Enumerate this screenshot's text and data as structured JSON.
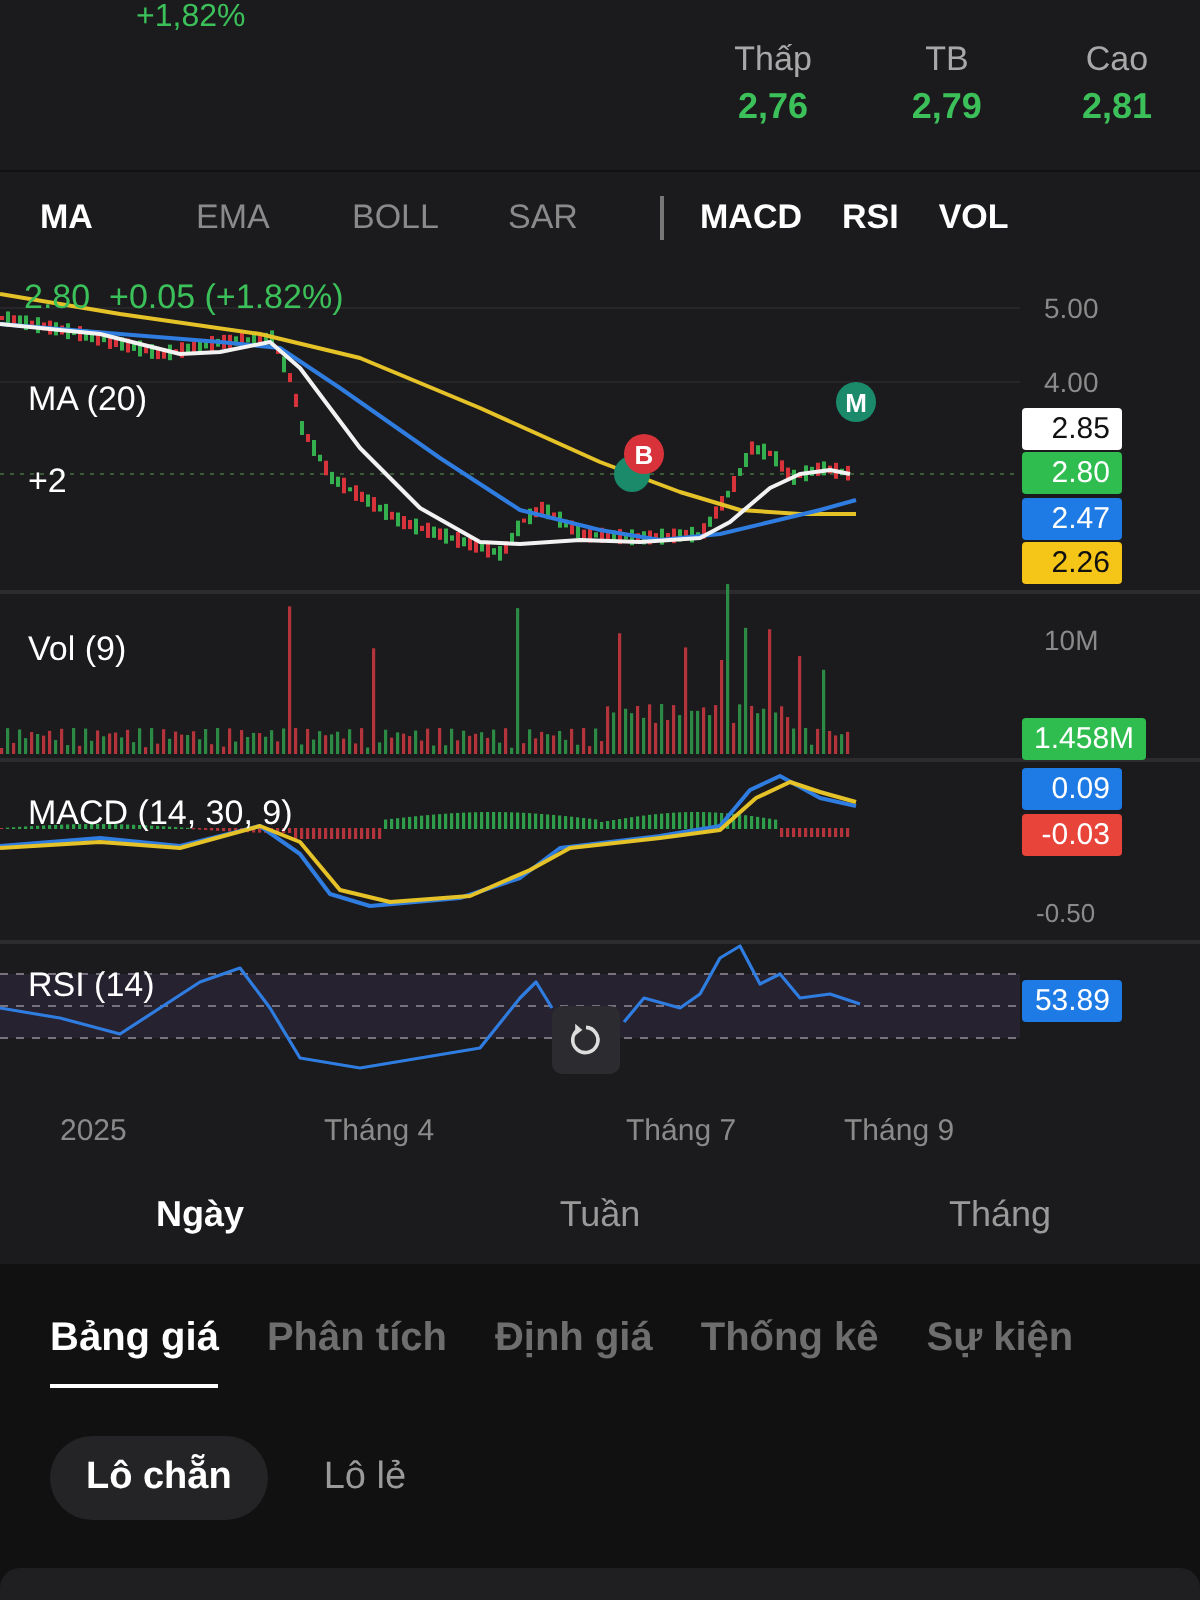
{
  "header": {
    "change": "+1,82%",
    "stats": [
      {
        "label": "Thấp",
        "value": "2,76"
      },
      {
        "label": "TB",
        "value": "2,79"
      },
      {
        "label": "Cao",
        "value": "2,81"
      }
    ]
  },
  "indicators": [
    {
      "label": "MA",
      "kind": "overlay",
      "selected": true
    },
    {
      "label": "EMA",
      "kind": "overlay",
      "selected": false
    },
    {
      "label": "BOLL",
      "kind": "overlay",
      "selected": false
    },
    {
      "label": "SAR",
      "kind": "overlay",
      "selected": false
    },
    {
      "label": "MACD",
      "kind": "oscillator",
      "selected": true
    },
    {
      "label": "RSI",
      "kind": "oscillator",
      "selected": true
    },
    {
      "label": "VOL",
      "kind": "oscillator",
      "selected": true
    }
  ],
  "chart": {
    "price_label": "2.80  +0.05 (+1.82%)",
    "ma_label": "MA (20)",
    "offset_label": "+2",
    "price_axis": [
      "5.00",
      "4.00"
    ],
    "price_tags": [
      {
        "value": "2.85",
        "color": "#ffffff"
      },
      {
        "value": "2.80",
        "color": "#2ebd4e"
      },
      {
        "value": "2.47",
        "color": "#1e7be6"
      },
      {
        "value": "2.26",
        "color": "#f5c518"
      }
    ],
    "markers": [
      {
        "label": "B",
        "color": "#d8333b"
      },
      {
        "label": "M",
        "color": "#1a8a6a"
      }
    ],
    "vol_label": "Vol (9)",
    "vol_axis": "10M",
    "vol_tag": {
      "value": "1.458M",
      "color": "#2ebd4e"
    },
    "macd_label": "MACD (14, 30, 9)",
    "macd_tags": [
      {
        "value": "0.09",
        "color": "#1e7be6"
      },
      {
        "value": "-0.03",
        "color": "#e8443a"
      }
    ],
    "macd_axis": "-0.50",
    "rsi_label": "RSI (14)",
    "rsi_tag": {
      "value": "53.89",
      "color": "#1e7be6"
    },
    "x_axis": [
      "2025",
      "Tháng 4",
      "Tháng 7",
      "Tháng 9"
    ]
  },
  "periods": [
    {
      "label": "Ngày",
      "selected": true
    },
    {
      "label": "Tuần",
      "selected": false
    },
    {
      "label": "Tháng",
      "selected": false
    }
  ],
  "tabs": [
    {
      "label": "Bảng giá",
      "selected": true
    },
    {
      "label": "Phân tích",
      "selected": false
    },
    {
      "label": "Định giá",
      "selected": false
    },
    {
      "label": "Thống kê",
      "selected": false
    },
    {
      "label": "Sự kiện",
      "selected": false
    }
  ],
  "lots": [
    {
      "label": "Lô chẵn",
      "selected": true
    },
    {
      "label": "Lô lẻ",
      "selected": false
    }
  ]
}
